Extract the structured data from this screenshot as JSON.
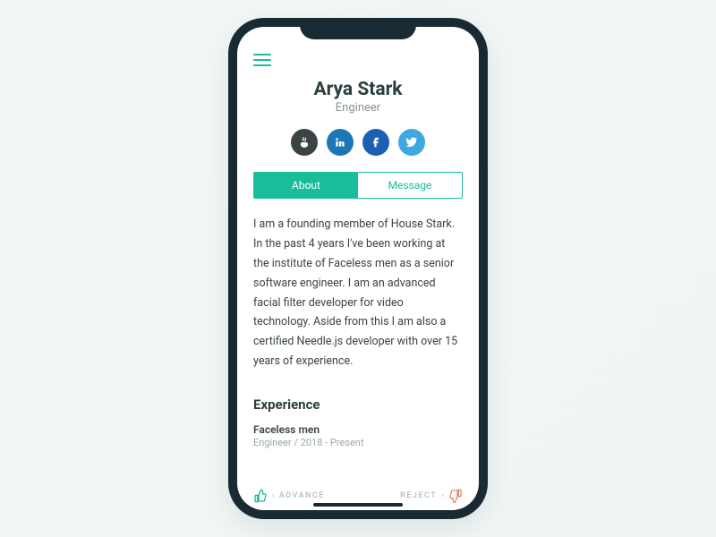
{
  "profile": {
    "name": "Arya Stark",
    "role": "Engineer"
  },
  "socials": [
    {
      "name": "angellist",
      "color": "#3a4444"
    },
    {
      "name": "linkedin",
      "color": "#1d76b5"
    },
    {
      "name": "facebook",
      "color": "#1d5fb5"
    },
    {
      "name": "twitter",
      "color": "#3ea8e0"
    }
  ],
  "tabs": {
    "about": "About",
    "message": "Message"
  },
  "bio": "I am a founding member of House Stark. In the past 4 years I've been working at the institute of Faceless men as a senior software engineer. I am an advanced facial filter developer for video technology. Aside from this I am also a certified Needle.js developer with over 15 years of experience.",
  "experience": {
    "heading": "Experience",
    "items": [
      {
        "company": "Faceless men",
        "meta": "Engineer / 2018 - Present"
      }
    ]
  },
  "actions": {
    "advance": "ADVANCE",
    "reject": "REJECT"
  },
  "colors": {
    "accent": "#1abc9c",
    "reject": "#e08a6e"
  }
}
